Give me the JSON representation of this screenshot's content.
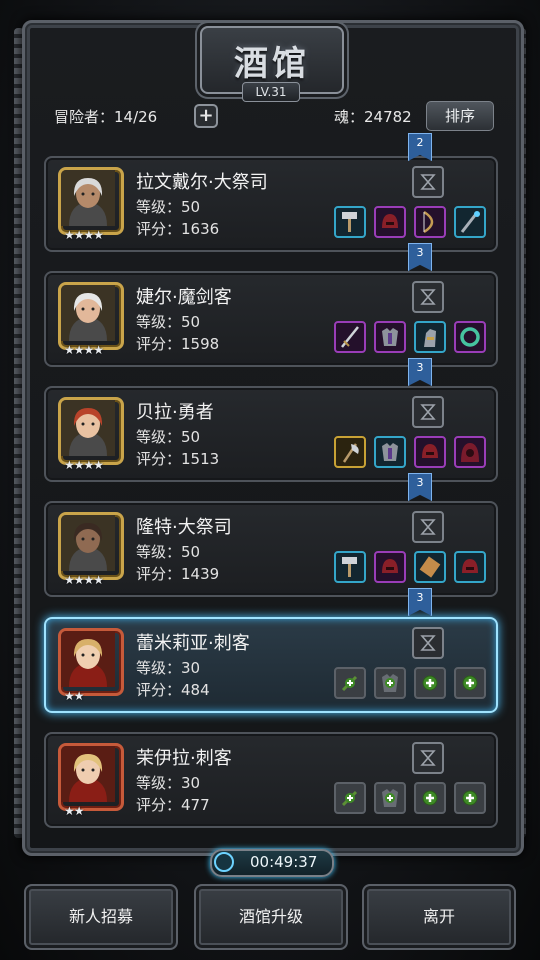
{
  "title": "酒馆",
  "level_badge": "LV.31",
  "header": {
    "adventurers": "冒险者：14/26",
    "add_symbol": "+",
    "soul": "魂：24782",
    "sort_label": "排序"
  },
  "ranks": [
    "2",
    "3",
    "3",
    "3",
    "3"
  ],
  "heroes": [
    {
      "name": "拉文戴尔·大祭司",
      "level": "等级：50",
      "score": "评分：1636",
      "stars": "★★★★",
      "selected": false,
      "equipment": [
        {
          "frame": "blue",
          "icon": "hammer-icon"
        },
        {
          "frame": "purple",
          "icon": "helmet-icon"
        },
        {
          "frame": "purple",
          "icon": "bow-icon"
        },
        {
          "frame": "blue",
          "icon": "staff-icon"
        }
      ]
    },
    {
      "name": "婕尔·魔剑客",
      "level": "等级：50",
      "score": "评分：1598",
      "stars": "★★★★",
      "selected": false,
      "equipment": [
        {
          "frame": "purple",
          "icon": "sword-icon"
        },
        {
          "frame": "purple",
          "icon": "armor-icon"
        },
        {
          "frame": "blue",
          "icon": "gauntlet-icon"
        },
        {
          "frame": "purple",
          "icon": "ring-icon"
        }
      ]
    },
    {
      "name": "贝拉·勇者",
      "level": "等级：50",
      "score": "评分：1513",
      "stars": "★★★★",
      "selected": false,
      "equipment": [
        {
          "frame": "gold",
          "icon": "axe-icon"
        },
        {
          "frame": "blue",
          "icon": "armor-icon"
        },
        {
          "frame": "purple",
          "icon": "helmet-icon"
        },
        {
          "frame": "purple",
          "icon": "hood-icon"
        }
      ]
    },
    {
      "name": "隆特·大祭司",
      "level": "等级：50",
      "score": "评分：1439",
      "stars": "★★★★",
      "selected": false,
      "equipment": [
        {
          "frame": "blue",
          "icon": "hammer-icon"
        },
        {
          "frame": "purple",
          "icon": "helmet-icon"
        },
        {
          "frame": "blue",
          "icon": "scroll-icon"
        },
        {
          "frame": "blue",
          "icon": "helmet-icon"
        }
      ]
    },
    {
      "name": "蕾米莉亚·刺客",
      "level": "等级：30",
      "score": "评分：484",
      "stars": "★★",
      "selected": true,
      "equipment": [
        {
          "frame": "empty",
          "icon": "dagger-slot-icon"
        },
        {
          "frame": "empty",
          "icon": "armor-slot-icon"
        },
        {
          "frame": "empty",
          "icon": "add-slot-icon"
        },
        {
          "frame": "empty",
          "icon": "add-slot-icon"
        }
      ]
    },
    {
      "name": "茉伊拉·刺客",
      "level": "等级：30",
      "score": "评分：477",
      "stars": "★★",
      "selected": false,
      "equipment": [
        {
          "frame": "empty",
          "icon": "dagger-slot-icon"
        },
        {
          "frame": "empty",
          "icon": "armor-slot-icon"
        },
        {
          "frame": "empty",
          "icon": "add-slot-icon"
        },
        {
          "frame": "empty",
          "icon": "add-slot-icon"
        }
      ]
    }
  ],
  "timer": "00:49:37",
  "buttons": {
    "recruit": "新人招募",
    "upgrade": "酒馆升级",
    "leave": "离开"
  }
}
